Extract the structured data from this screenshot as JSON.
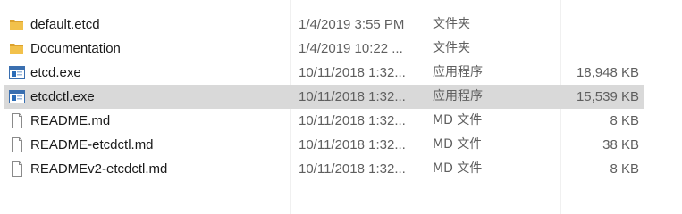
{
  "files": [
    {
      "name": "default.etcd",
      "modified": "1/4/2019 3:55 PM",
      "type": "文件夹",
      "size": "",
      "icon": "folder-icon",
      "selected": false
    },
    {
      "name": "Documentation",
      "modified": "1/4/2019 10:22 ...",
      "type": "文件夹",
      "size": "",
      "icon": "folder-icon",
      "selected": false
    },
    {
      "name": "etcd.exe",
      "modified": "10/11/2018 1:32...",
      "type": "应用程序",
      "size": "18,948 KB",
      "icon": "application-icon",
      "selected": false
    },
    {
      "name": "etcdctl.exe",
      "modified": "10/11/2018 1:32...",
      "type": "应用程序",
      "size": "15,539 KB",
      "icon": "application-icon",
      "selected": true
    },
    {
      "name": "README.md",
      "modified": "10/11/2018 1:32...",
      "type": "MD 文件",
      "size": "8 KB",
      "icon": "document-icon",
      "selected": false
    },
    {
      "name": "README-etcdctl.md",
      "modified": "10/11/2018 1:32...",
      "type": "MD 文件",
      "size": "38 KB",
      "icon": "document-icon",
      "selected": false
    },
    {
      "name": "READMEv2-etcdctl.md",
      "modified": "10/11/2018 1:32...",
      "type": "MD 文件",
      "size": "8 KB",
      "icon": "document-icon",
      "selected": false
    }
  ],
  "colors": {
    "folder": "#f2c14b",
    "folder_dark": "#dca22e",
    "selection": "#d9d9d9",
    "app_blue": "#2b6cb8"
  }
}
